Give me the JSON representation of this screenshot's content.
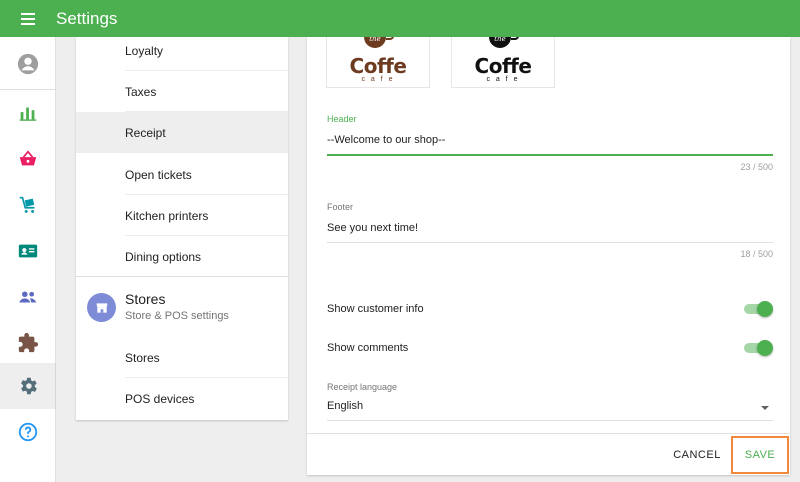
{
  "app": {
    "title": "Settings"
  },
  "menu": {
    "items": [
      {
        "label": "Loyalty"
      },
      {
        "label": "Taxes"
      },
      {
        "label": "Receipt"
      },
      {
        "label": "Open tickets"
      },
      {
        "label": "Kitchen printers"
      },
      {
        "label": "Dining options"
      }
    ],
    "section": {
      "title": "Stores",
      "subtitle": "Store & POS settings"
    },
    "section_items": [
      {
        "label": "Stores"
      },
      {
        "label": "POS devices"
      }
    ]
  },
  "receipt": {
    "logos": [
      {
        "word": "Coffe",
        "badge": "the",
        "tagline": "c a f e",
        "color": "#6d3b1f"
      },
      {
        "word": "Coffe",
        "badge": "the",
        "tagline": "c a f e",
        "color": "#111111"
      }
    ],
    "header": {
      "label": "Header",
      "value": "--Welcome to our shop--",
      "counter": "23 / 500"
    },
    "footer": {
      "label": "Footer",
      "value": "See you next time!",
      "counter": "18 / 500"
    },
    "show_customer_info": {
      "label": "Show customer info",
      "on": true
    },
    "show_comments": {
      "label": "Show comments",
      "on": true
    },
    "language": {
      "label": "Receipt language",
      "value": "English"
    }
  },
  "actions": {
    "cancel": "CANCEL",
    "save": "SAVE"
  },
  "colors": {
    "primary": "#4caf50",
    "highlight": "#f0883e",
    "avatar": "#7e8bd6"
  }
}
